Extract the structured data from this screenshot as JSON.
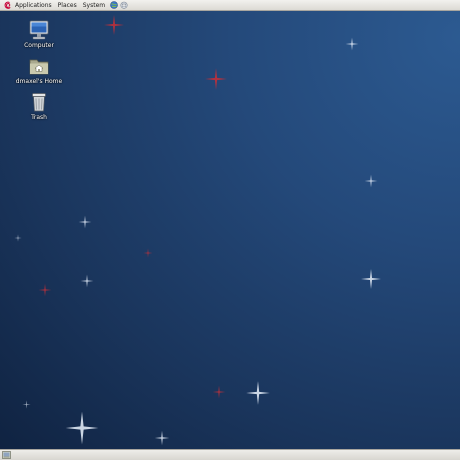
{
  "top_panel": {
    "menus": [
      {
        "label": "Applications"
      },
      {
        "label": "Places"
      },
      {
        "label": "System"
      }
    ],
    "launchers": [
      "web-browser-icon",
      "mail-client-icon"
    ]
  },
  "desktop_icons": [
    {
      "label": "Computer",
      "icon": "computer-icon"
    },
    {
      "label": "dmaxel's Home",
      "icon": "home-folder-icon"
    },
    {
      "label": "Trash",
      "icon": "trash-icon"
    }
  ],
  "bottom_panel": {
    "items": [
      "show-desktop-icon"
    ]
  },
  "colors": {
    "panel": "#e6e4df",
    "desktop_light": "#2c5a91",
    "desktop_dark": "#0f2240",
    "star_white": "#dfe8f4",
    "star_red": "#c0303a"
  }
}
